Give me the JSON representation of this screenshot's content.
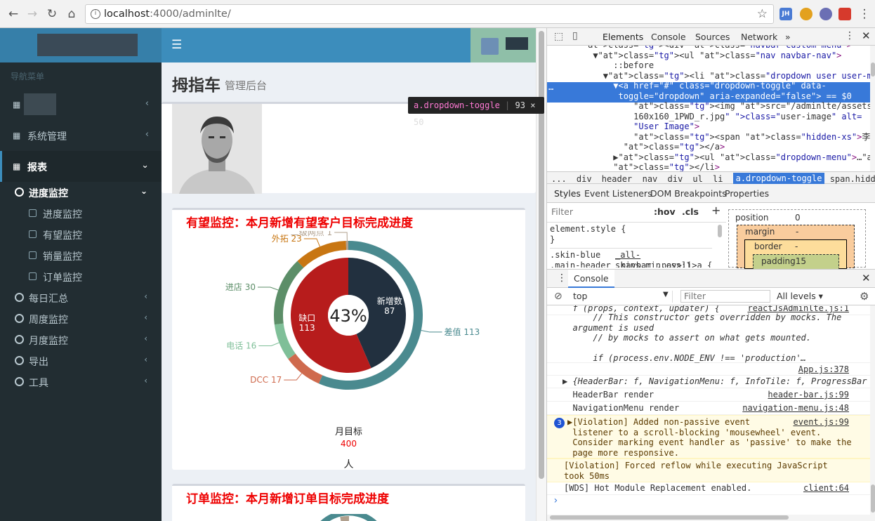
{
  "browser": {
    "url_host": "localhost",
    "url_path": ":4000/adminlte/",
    "extensions": [
      "JH",
      "ext-2",
      "ext-3",
      "ext-4"
    ]
  },
  "app": {
    "sidebar_header": "导航菜单",
    "sidebar_items": [
      {
        "label": "",
        "icon": "grid-icon",
        "expanded": false
      },
      {
        "label": "系统管理",
        "icon": "grid-icon",
        "expanded": false
      },
      {
        "label": "报表",
        "icon": "grid-icon",
        "expanded": true
      }
    ],
    "sidebar_subgroups": [
      {
        "label": "进度监控",
        "expanded": true,
        "children": [
          "进度监控",
          "有望监控",
          "销量监控",
          "订单监控"
        ]
      },
      {
        "label": "每日汇总"
      },
      {
        "label": "周度监控"
      },
      {
        "label": "月度监控"
      },
      {
        "label": "导出"
      },
      {
        "label": "工具"
      }
    ],
    "page_title": "拇指车",
    "page_subtitle": "管理后台",
    "box1_title": "有望监控：本月新增有望客户目标完成进度",
    "box2_title": "订单监控：本月新增订单目标完成进度",
    "month_target_label": "月目标",
    "month_target_value": "400",
    "unit": "人",
    "tooltip": {
      "tag": "a.dropdown-toggle",
      "size": "93 × 50"
    }
  },
  "chart_data": {
    "type": "pie",
    "center_label": "43%",
    "inner": [
      {
        "name": "新增数",
        "value": 87,
        "color": "#22303f"
      },
      {
        "name": "缺口",
        "value": 113,
        "color": "#b71c1c"
      }
    ],
    "outer": [
      {
        "name": "差值",
        "value": 113,
        "color": "#4a8a8f"
      },
      {
        "name": "DCC",
        "value": 17,
        "color": "#cf6a4d"
      },
      {
        "name": "电话",
        "value": 16,
        "color": "#7fbf98"
      },
      {
        "name": "进店",
        "value": 30,
        "color": "#5c8e68"
      },
      {
        "name": "外拓",
        "value": 23,
        "color": "#c87612"
      },
      {
        "name": "二级网点",
        "value": 1,
        "color": "#b0a08e"
      }
    ]
  },
  "devtools": {
    "tabs": [
      "Elements",
      "Console",
      "Sources",
      "Network"
    ],
    "more": "»",
    "elements_lines": [
      "    <div class=\"navbar-custom-menu\">",
      "      ▼<ul class=\"nav navbar-nav\">",
      "          ::before",
      "        ▼<li class=\"dropdown user user-menu\">",
      "          ▼<a href=\"#\" class=\"dropdown-toggle\" data-",
      "           toggle=\"dropdown\" aria-expanded=\"false\"> == $0",
      "              <img src=\"/adminlte/assets/img/user2-",
      "              160x160_1PWD_r.jpg\" class=\"user-image\" alt=",
      "              \"User Image\">",
      "              <span class=\"hidden-xs\">李茂</span>",
      "            </a>",
      "          ▶<ul class=\"dropdown-menu\">…</ul>",
      "          </li>"
    ],
    "breadcrumbs": [
      "...",
      "div",
      "header",
      "nav",
      "div",
      "ul",
      "li",
      "a.dropdown-toggle",
      "span.hidden-xs"
    ],
    "style_tabs": [
      "Styles",
      "Event Listeners",
      "DOM Breakpoints",
      "Properties"
    ],
    "filter_placeholder": "Filter",
    "hov": ":hov",
    "cls": ".cls",
    "plus": "+",
    "styles_lines": [
      "element.style {",
      "}",
      ".skin-blue",
      ".main-header .navbar .nav>li>a {"
    ],
    "styles_source": "_all-skins.min.css:1",
    "boxmodel": {
      "position": "position",
      "position_val": "0",
      "margin": "margin",
      "margin_val": "-",
      "border": "border",
      "border_val": "-",
      "padding": "padding15"
    },
    "console_title": "Console",
    "console_context": "top",
    "console_filter": "Filter",
    "console_levels": "All levels ▾",
    "console_lines": [
      {
        "text": "  f (props, context, updater) {",
        "source": "reactJsAdminlte.js:1"
      },
      {
        "text": "      // This constructor gets overridden by mocks. The\n  argument is used\n      // by mocks to assert on what gets mounted.\n\n      if (process.env.NODE_ENV !== 'production'…",
        "source": ""
      },
      {
        "text": "",
        "source": "App.js:378"
      },
      {
        "text": "▶ {HeaderBar: f, NavigationMenu: f, InfoTile: f, ProgressBar",
        "source": ""
      },
      {
        "text": "  HeaderBar render",
        "source": "header-bar.js:99"
      },
      {
        "text": "  NavigationMenu render",
        "source": "navigation-menu.js:48"
      }
    ],
    "warn_count": "3",
    "warn_lines": [
      {
        "text": "▶[Violation] Added non-passive event\n listener to a scroll-blocking 'mousewheel' event.\n Consider marking event handler as 'passive' to make the\n page more responsive.",
        "source": "event.js:99"
      },
      {
        "text": "[Violation] Forced reflow while executing JavaScript\ntook 50ms",
        "source": ""
      }
    ],
    "wds_line": "[WDS] Hot Module Replacement enabled.",
    "wds_source": "client:64",
    "prompt": "›"
  }
}
